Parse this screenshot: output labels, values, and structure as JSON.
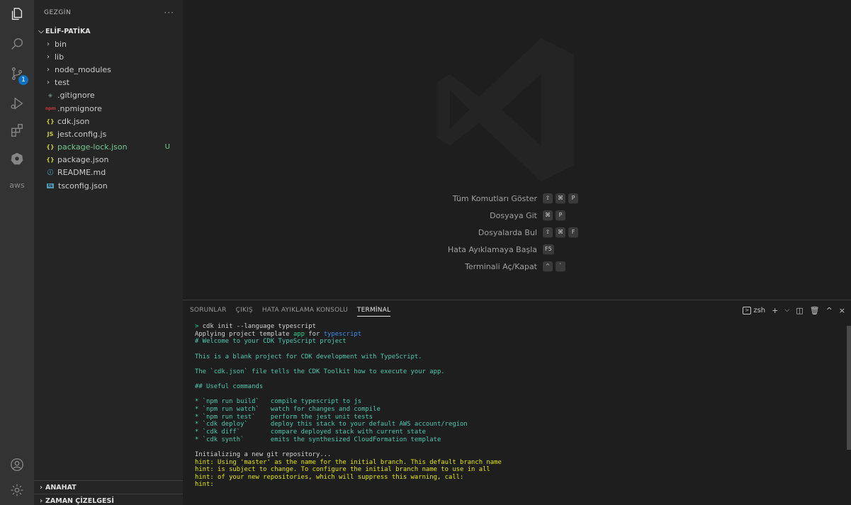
{
  "sidebar": {
    "title": "GEZGİN",
    "more": "···",
    "project": "ELİF-PATİKA",
    "folders": [
      "bin",
      "lib",
      "node_modules",
      "test"
    ],
    "files": [
      {
        "name": ".gitignore",
        "icon": "◈",
        "color": "#6d8086",
        "status": ""
      },
      {
        "name": ".npmignore",
        "icon": "npm",
        "color": "#cb3837",
        "status": ""
      },
      {
        "name": "cdk.json",
        "icon": "{}",
        "color": "#cbcb41",
        "status": ""
      },
      {
        "name": "jest.config.js",
        "icon": "JS",
        "color": "#cbcb41",
        "status": ""
      },
      {
        "name": "package-lock.json",
        "icon": "{}",
        "color": "#cbcb41",
        "status": "U"
      },
      {
        "name": "package.json",
        "icon": "{}",
        "color": "#cbcb41",
        "status": ""
      },
      {
        "name": "README.md",
        "icon": "ⓘ",
        "color": "#519aba",
        "status": ""
      },
      {
        "name": "tsconfig.json",
        "icon": "ts",
        "color": "#519aba",
        "status": ""
      }
    ],
    "outline": "ANAHAT",
    "timeline": "ZAMAN ÇİZELGESİ"
  },
  "activity": {
    "scm_badge": "1",
    "aws_label": "aws"
  },
  "welcome": {
    "shortcuts": [
      {
        "label": "Tüm Komutları Göster",
        "keys": [
          "⇧",
          "⌘",
          "P"
        ]
      },
      {
        "label": "Dosyaya Git",
        "keys": [
          "⌘",
          "P"
        ]
      },
      {
        "label": "Dosyalarda Bul",
        "keys": [
          "⇧",
          "⌘",
          "F"
        ]
      },
      {
        "label": "Hata Ayıklamaya Başla",
        "keys": [
          "F5"
        ]
      },
      {
        "label": "Terminali Aç/Kapat",
        "keys": [
          "^",
          "`"
        ]
      }
    ]
  },
  "panel": {
    "tabs": [
      "SORUNLAR",
      "ÇIKIŞ",
      "HATA AYIKLAMA KONSOLU",
      "TERMİNAL"
    ],
    "active_tab": "TERMİNAL",
    "shell": "zsh"
  },
  "terminal": {
    "lines": [
      {
        "segments": [
          {
            "t": "> ",
            "c": "c-green"
          },
          {
            "t": "cdk init --language typescript",
            "c": "c-white"
          }
        ]
      },
      {
        "segments": [
          {
            "t": "Applying project template ",
            "c": "c-white"
          },
          {
            "t": "app",
            "c": "c-green"
          },
          {
            "t": " for ",
            "c": "c-white"
          },
          {
            "t": "typescript",
            "c": "c-blue"
          }
        ]
      },
      {
        "segments": [
          {
            "t": "# Welcome to your CDK TypeScript project",
            "c": "c-green2"
          }
        ]
      },
      {
        "segments": [
          {
            "t": "",
            "c": "c-white"
          }
        ]
      },
      {
        "segments": [
          {
            "t": "This is a blank project for CDK development with TypeScript.",
            "c": "c-green2"
          }
        ]
      },
      {
        "segments": [
          {
            "t": "",
            "c": "c-white"
          }
        ]
      },
      {
        "segments": [
          {
            "t": "The `cdk.json` file tells the CDK Toolkit how to execute your app.",
            "c": "c-green2"
          }
        ]
      },
      {
        "segments": [
          {
            "t": "",
            "c": "c-white"
          }
        ]
      },
      {
        "segments": [
          {
            "t": "## Useful commands",
            "c": "c-green2"
          }
        ]
      },
      {
        "segments": [
          {
            "t": "",
            "c": "c-white"
          }
        ]
      },
      {
        "segments": [
          {
            "t": "* `npm run build`   compile typescript to js",
            "c": "c-green2"
          }
        ]
      },
      {
        "segments": [
          {
            "t": "* `npm run watch`   watch for changes and compile",
            "c": "c-green2"
          }
        ]
      },
      {
        "segments": [
          {
            "t": "* `npm run test`    perform the jest unit tests",
            "c": "c-green2"
          }
        ]
      },
      {
        "segments": [
          {
            "t": "* `cdk deploy`      deploy this stack to your default AWS account/region",
            "c": "c-green2"
          }
        ]
      },
      {
        "segments": [
          {
            "t": "* `cdk diff`        compare deployed stack with current state",
            "c": "c-green2"
          }
        ]
      },
      {
        "segments": [
          {
            "t": "* `cdk synth`       emits the synthesized CloudFormation template",
            "c": "c-green2"
          }
        ]
      },
      {
        "segments": [
          {
            "t": "",
            "c": "c-white"
          }
        ]
      },
      {
        "segments": [
          {
            "t": "Initializing a new git repository...",
            "c": "c-white"
          }
        ]
      },
      {
        "segments": [
          {
            "t": "hint: Using 'master' as the name for the initial branch. This default branch name",
            "c": "c-yellow"
          }
        ]
      },
      {
        "segments": [
          {
            "t": "hint: is subject to change. To configure the initial branch name to use in all",
            "c": "c-yellow"
          }
        ]
      },
      {
        "segments": [
          {
            "t": "hint: of your new repositories, which will suppress this warning, call:",
            "c": "c-yellow"
          }
        ]
      },
      {
        "segments": [
          {
            "t": "hint:",
            "c": "c-yellow"
          }
        ]
      }
    ]
  }
}
